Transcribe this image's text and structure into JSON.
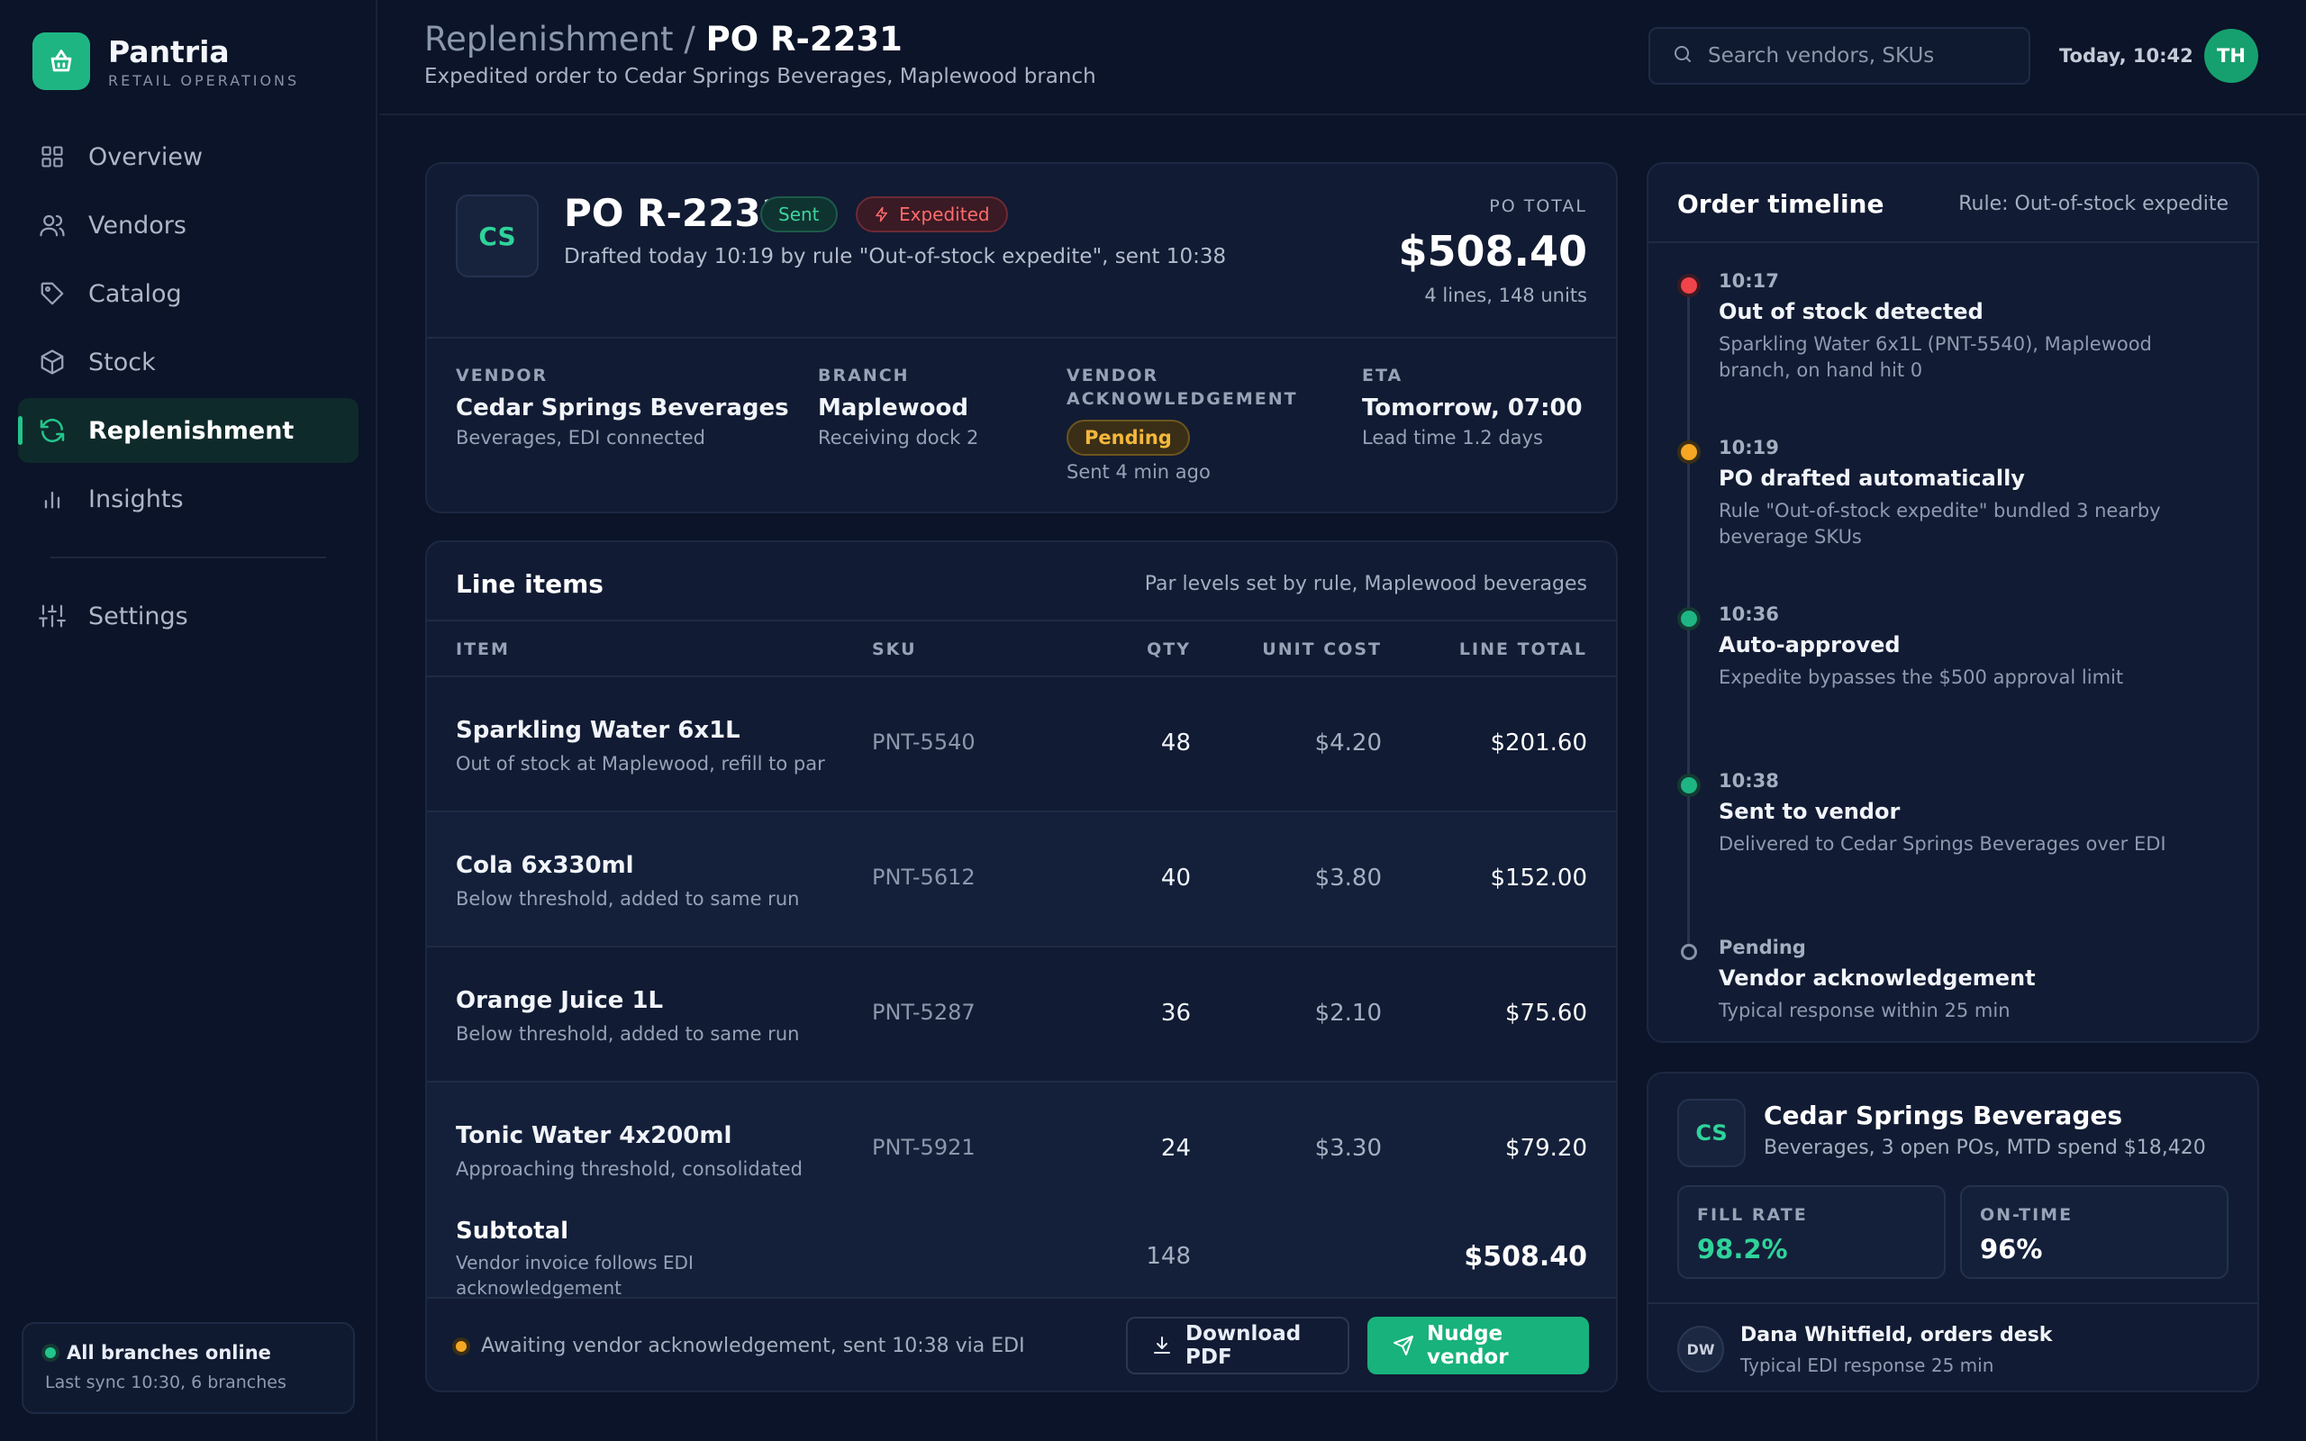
{
  "brand": {
    "name": "Pantria",
    "subtitle": "RETAIL OPERATIONS",
    "accent": "#1fb583"
  },
  "nav": [
    {
      "label": "Overview",
      "icon": "grid-icon"
    },
    {
      "label": "Vendors",
      "icon": "users-icon"
    },
    {
      "label": "Catalog",
      "icon": "tag-icon"
    },
    {
      "label": "Stock",
      "icon": "box-icon"
    },
    {
      "label": "Replenishment",
      "icon": "refresh-icon",
      "active": true
    },
    {
      "label": "Insights",
      "icon": "bar-chart-icon"
    },
    {
      "label": "Settings",
      "icon": "sliders-icon"
    }
  ],
  "status": {
    "title": "All branches online",
    "sub": "Last sync 10:30, 6 branches",
    "color": "#22c58b"
  },
  "header": {
    "crumb_parent": "Replenishment",
    "crumb_sep": " / ",
    "crumb_current": "PO R-2231",
    "subtitle": "Expedited order to Cedar Springs Beverages, Maplewood branch",
    "search_placeholder": "Search vendors, SKUs",
    "date": "Today, 10:42",
    "avatar": "TH"
  },
  "po": {
    "badge": "CS",
    "title": "PO R-2231",
    "status_sent": "Sent",
    "status_expedited": "Expedited",
    "desc": "Drafted today 10:19 by rule \"Out-of-stock expedite\", sent 10:38",
    "total_label": "PO TOTAL",
    "total": "$508.40",
    "total_sub": "4 lines, 148 units",
    "vendor_label": "VENDOR",
    "vendor": "Cedar Springs Beverages",
    "vendor_sub": "Beverages, EDI connected",
    "branch_label": "BRANCH",
    "branch": "Maplewood",
    "branch_sub": "Receiving dock 2",
    "ack_label_1": "VENDOR",
    "ack_label_2": "ACKNOWLEDGEMENT",
    "ack_status": "Pending",
    "ack_sub": "Sent 4 min ago",
    "eta_label": "ETA",
    "eta": "Tomorrow, 07:00",
    "eta_sub": "Lead time 1.2 days"
  },
  "items": {
    "title": "Line items",
    "note": "Par levels set by rule, Maplewood beverages",
    "headers": {
      "item": "ITEM",
      "sku": "SKU",
      "qty": "QTY",
      "unit": "UNIT COST",
      "line": "LINE TOTAL"
    },
    "rows": [
      {
        "name": "Sparkling Water 6x1L",
        "sub": "Out of stock at Maplewood, refill to par",
        "sku": "PNT-5540",
        "qty": "48",
        "unit": "$4.20",
        "line": "$201.60"
      },
      {
        "name": "Cola 6x330ml",
        "sub": "Below threshold, added to same run",
        "sku": "PNT-5612",
        "qty": "40",
        "unit": "$3.80",
        "line": "$152.00"
      },
      {
        "name": "Orange Juice 1L",
        "sub": "Below threshold, added to same run",
        "sku": "PNT-5287",
        "qty": "36",
        "unit": "$2.10",
        "line": "$75.60"
      },
      {
        "name": "Tonic Water 4x200ml",
        "sub": "Approaching threshold, consolidated",
        "sku": "PNT-5921",
        "qty": "24",
        "unit": "$3.30",
        "line": "$79.20"
      }
    ],
    "subtotal_label": "Subtotal",
    "subtotal_note": "Vendor invoice follows EDI acknowledgement",
    "subtotal_qty": "148",
    "subtotal_total": "$508.40",
    "footer_msg": "Awaiting vendor acknowledgement, sent 10:38 via EDI",
    "btn_pdf": "Download PDF",
    "btn_nudge": "Nudge vendor"
  },
  "timeline": {
    "title": "Order timeline",
    "rule": "Rule: Out-of-stock expedite",
    "events": [
      {
        "time": "10:17",
        "name": "Out of stock detected",
        "desc": "Sparkling Water 6x1L (PNT-5540), Maplewood branch, on hand hit 0",
        "color": "#f0434a"
      },
      {
        "time": "10:19",
        "name": "PO drafted automatically",
        "desc": "Rule \"Out-of-stock expedite\" bundled 3 nearby beverage SKUs",
        "color": "#f5a623"
      },
      {
        "time": "10:36",
        "name": "Auto-approved",
        "desc": "Expedite bypasses the $500 approval limit",
        "color": "#1fb583"
      },
      {
        "time": "10:38",
        "name": "Sent to vendor",
        "desc": "Delivered to Cedar Springs Beverages over EDI",
        "color": "#1fb583"
      },
      {
        "time": "Pending",
        "name": "Vendor acknowledgement",
        "desc": "Typical response within 25 min",
        "color": "#8793a8"
      }
    ]
  },
  "vendor": {
    "badge": "CS",
    "name": "Cedar Springs Beverages",
    "sub": "Beverages, 3 open POs, MTD spend $18,420",
    "fill_label": "FILL RATE",
    "fill_value": "98.2%",
    "ontime_label": "ON-TIME",
    "ontime_value": "96%",
    "contact_initials": "DW",
    "contact_name": "Dana Whitfield, orders desk",
    "contact_sub": "Typical EDI response 25 min"
  }
}
